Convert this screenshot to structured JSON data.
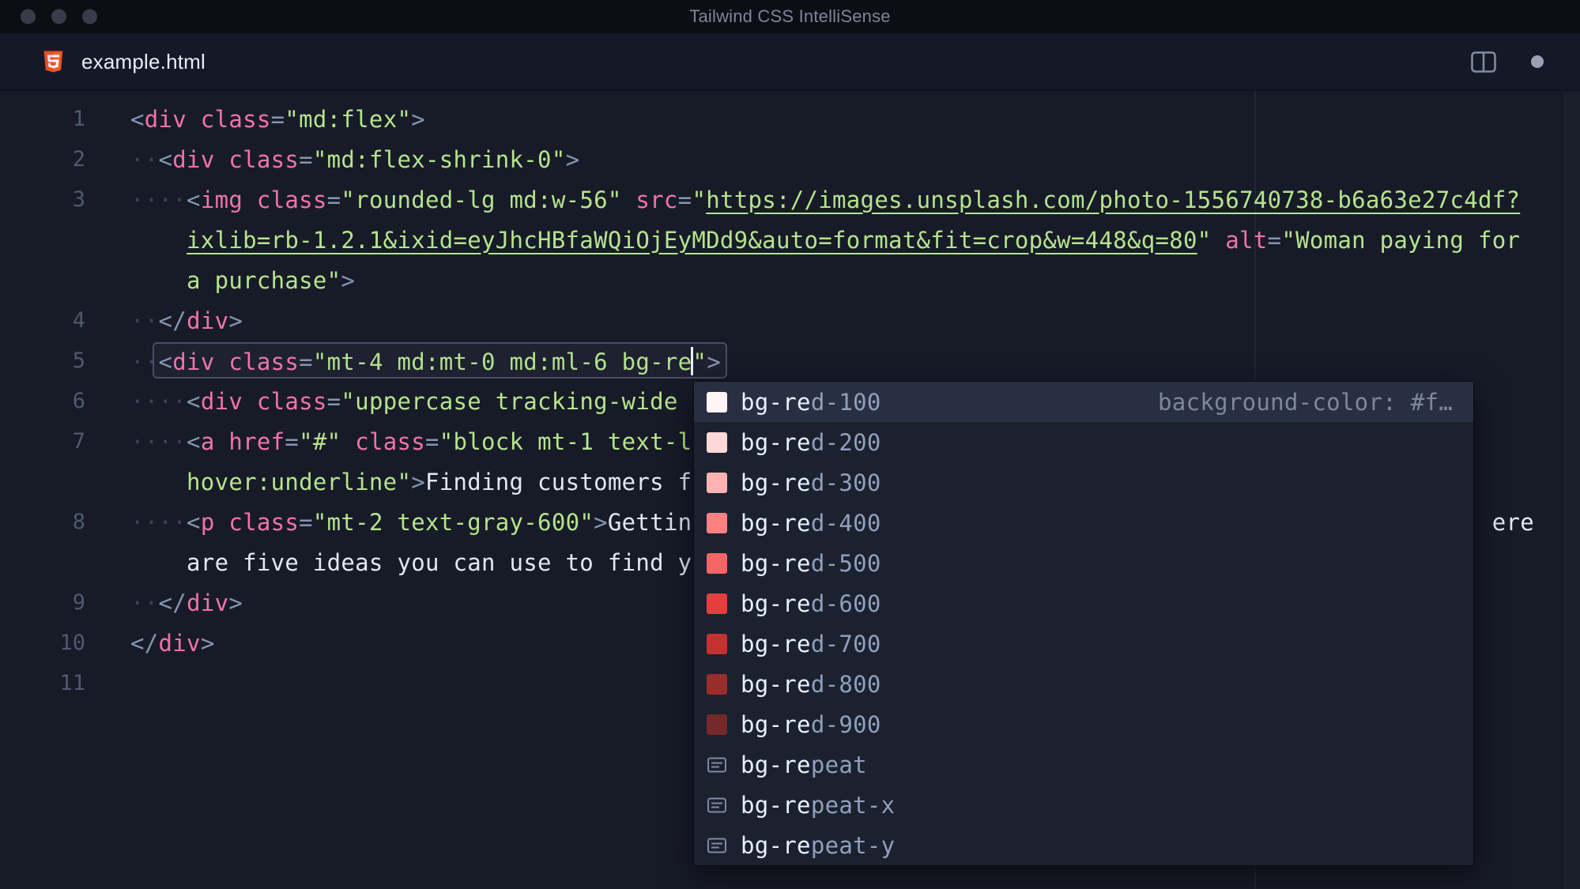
{
  "window": {
    "title": "Tailwind CSS IntelliSense"
  },
  "tab": {
    "filename": "example.html"
  },
  "palette": {
    "tag_pink": "#f173ac",
    "string_green": "#b5e48c",
    "punctuation_gray": "#8595b2",
    "plain_text": "#e2e7f2",
    "html5_orange": "#e34f26",
    "cursor_white": "#f2f5fb"
  },
  "editor": {
    "rows": [
      {
        "num": "1",
        "segments": [
          [
            "pun",
            "<"
          ],
          [
            "tag",
            "div"
          ],
          [
            "attr",
            " class"
          ],
          [
            "pun",
            "="
          ],
          [
            "str",
            "\"md:flex\""
          ],
          [
            "pun",
            ">"
          ]
        ]
      },
      {
        "num": "2",
        "segments": [
          [
            "ind",
            "··"
          ],
          [
            "pun",
            "<"
          ],
          [
            "tag",
            "div"
          ],
          [
            "attr",
            " class"
          ],
          [
            "pun",
            "="
          ],
          [
            "str",
            "\"md:flex-shrink-0\""
          ],
          [
            "pun",
            ">"
          ]
        ]
      },
      {
        "num": "3",
        "segments": [
          [
            "ind",
            "····"
          ],
          [
            "pun",
            "<"
          ],
          [
            "tag",
            "img"
          ],
          [
            "attr",
            " class"
          ],
          [
            "pun",
            "="
          ],
          [
            "str",
            "\"rounded-lg md:w-56\""
          ],
          [
            "attr",
            " src"
          ],
          [
            "pun",
            "="
          ],
          [
            "str",
            "\""
          ],
          [
            "lnk",
            "https://images.unsplash.com/photo-1556740738-b6a63e27c4df?"
          ]
        ]
      },
      {
        "num": "",
        "segments": [
          [
            "gap",
            "4"
          ],
          [
            "lnk",
            "ixlib=rb-1.2.1&ixid=eyJhcHBfaWQiOjEyMDd9&auto=format&fit=crop&w=448&q=80"
          ],
          [
            "str",
            "\""
          ],
          [
            "attr",
            " alt"
          ],
          [
            "pun",
            "="
          ],
          [
            "str",
            "\"Woman paying for"
          ]
        ]
      },
      {
        "num": "",
        "segments": [
          [
            "gap",
            "4"
          ],
          [
            "str",
            "a purchase\""
          ],
          [
            "pun",
            ">"
          ]
        ]
      },
      {
        "num": "4",
        "segments": [
          [
            "ind",
            "··"
          ],
          [
            "pun",
            "</"
          ],
          [
            "tag",
            "div"
          ],
          [
            "pun",
            ">"
          ]
        ]
      },
      {
        "num": "5",
        "current": true,
        "segments": [
          [
            "ind",
            "··"
          ],
          [
            "pun",
            "<"
          ],
          [
            "tag",
            "div"
          ],
          [
            "attr",
            " class"
          ],
          [
            "pun",
            "="
          ],
          [
            "str",
            "\"mt-4 md:mt-0 md:ml-6 bg-re"
          ],
          [
            "cursor",
            ""
          ],
          [
            "str",
            "\""
          ],
          [
            "pun",
            ">"
          ]
        ]
      },
      {
        "num": "6",
        "segments": [
          [
            "ind",
            "····"
          ],
          [
            "pun",
            "<"
          ],
          [
            "tag",
            "div"
          ],
          [
            "attr",
            " class"
          ],
          [
            "pun",
            "="
          ],
          [
            "str",
            "\"uppercase tracking-wide "
          ]
        ]
      },
      {
        "num": "7",
        "segments": [
          [
            "ind",
            "····"
          ],
          [
            "pun",
            "<"
          ],
          [
            "tag",
            "a"
          ],
          [
            "attr",
            " href"
          ],
          [
            "pun",
            "="
          ],
          [
            "str",
            "\"#\""
          ],
          [
            "attr",
            " class"
          ],
          [
            "pun",
            "="
          ],
          [
            "str",
            "\"block mt-1 text-l"
          ]
        ]
      },
      {
        "num": "",
        "segments": [
          [
            "gap",
            "4"
          ],
          [
            "str",
            "hover:underline\""
          ],
          [
            "pun",
            ">"
          ],
          [
            "txt",
            "Finding customers f"
          ]
        ]
      },
      {
        "num": "8",
        "segments": [
          [
            "ind",
            "····"
          ],
          [
            "pun",
            "<"
          ],
          [
            "tag",
            "p"
          ],
          [
            "attr",
            " class"
          ],
          [
            "pun",
            "="
          ],
          [
            "str",
            "\"mt-2 text-gray-600\""
          ],
          [
            "pun",
            ">"
          ],
          [
            "txt",
            "Gettin"
          ],
          [
            "gap",
            "57"
          ],
          [
            "txt",
            "ere"
          ]
        ]
      },
      {
        "num": "",
        "segments": [
          [
            "gap",
            "4"
          ],
          [
            "txt",
            "are five ideas you can use to find y"
          ]
        ]
      },
      {
        "num": "9",
        "segments": [
          [
            "ind",
            "··"
          ],
          [
            "pun",
            "</"
          ],
          [
            "tag",
            "div"
          ],
          [
            "pun",
            ">"
          ]
        ]
      },
      {
        "num": "10",
        "segments": [
          [
            "pun",
            "</"
          ],
          [
            "tag",
            "div"
          ],
          [
            "pun",
            ">"
          ]
        ]
      },
      {
        "num": "11",
        "segments": []
      }
    ]
  },
  "suggest": {
    "items": [
      {
        "kind": "color",
        "color": "#fff5f5",
        "match": "bg-re",
        "rest": "d-100",
        "detail": "background-color: #f…",
        "selected": true
      },
      {
        "kind": "color",
        "color": "#fed7d7",
        "match": "bg-re",
        "rest": "d-200"
      },
      {
        "kind": "color",
        "color": "#feb2b2",
        "match": "bg-re",
        "rest": "d-300"
      },
      {
        "kind": "color",
        "color": "#fc8181",
        "match": "bg-re",
        "rest": "d-400"
      },
      {
        "kind": "color",
        "color": "#f56565",
        "match": "bg-re",
        "rest": "d-500"
      },
      {
        "kind": "color",
        "color": "#e53e3e",
        "match": "bg-re",
        "rest": "d-600"
      },
      {
        "kind": "color",
        "color": "#c53030",
        "match": "bg-re",
        "rest": "d-700"
      },
      {
        "kind": "color",
        "color": "#9b2c2c",
        "match": "bg-re",
        "rest": "d-800"
      },
      {
        "kind": "color",
        "color": "#742a2a",
        "match": "bg-re",
        "rest": "d-900"
      },
      {
        "kind": "text",
        "match": "bg-re",
        "rest": "peat"
      },
      {
        "kind": "text",
        "match": "bg-re",
        "rest": "peat-x"
      },
      {
        "kind": "text",
        "match": "bg-re",
        "rest": "peat-y"
      }
    ]
  }
}
